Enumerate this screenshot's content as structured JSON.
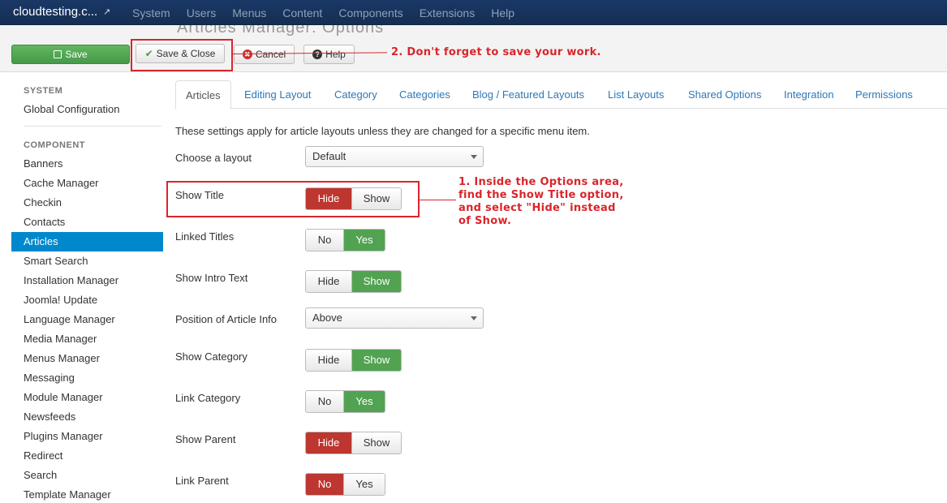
{
  "navbar": {
    "site_name": "cloudtesting.c...",
    "external_icon": "external-link-icon",
    "menu": [
      "System",
      "Users",
      "Menus",
      "Content",
      "Components",
      "Extensions",
      "Help"
    ]
  },
  "toolbar": {
    "ghost_title": "Articles Manager: Options",
    "save_label": "Save",
    "save_close_label": "Save & Close",
    "cancel_label": "Cancel",
    "help_label": "Help"
  },
  "annotations": {
    "note_save": "2. Don't forget to save your work.",
    "note_title_1": "1. Inside the Options area,",
    "note_title_2": "find the Show Title option,",
    "note_title_3": "and select \"Hide\" instead",
    "note_title_4": "of Show."
  },
  "sidebar": {
    "system_heading": "SYSTEM",
    "global_config": "Global Configuration",
    "component_heading": "COMPONENT",
    "items": [
      "Banners",
      "Cache Manager",
      "Checkin",
      "Contacts",
      "Articles",
      "Smart Search",
      "Installation Manager",
      "Joomla! Update",
      "Language Manager",
      "Media Manager",
      "Menus Manager",
      "Messaging",
      "Module Manager",
      "Newsfeeds",
      "Plugins Manager",
      "Redirect",
      "Search",
      "Template Manager"
    ],
    "active_item": "Articles"
  },
  "tabs": [
    "Articles",
    "Editing Layout",
    "Category",
    "Categories",
    "Blog / Featured Layouts",
    "List Layouts",
    "Shared Options",
    "Integration",
    "Permissions"
  ],
  "form": {
    "description": "These settings apply for article layouts unless they are changed for a specific menu item.",
    "choose_layout": {
      "label": "Choose a layout",
      "value": "Default"
    },
    "show_title": {
      "label": "Show Title",
      "options": [
        "Hide",
        "Show"
      ],
      "selected": "Hide"
    },
    "linked_titles": {
      "label": "Linked Titles",
      "options": [
        "No",
        "Yes"
      ],
      "selected": "Yes"
    },
    "show_intro": {
      "label": "Show Intro Text",
      "options": [
        "Hide",
        "Show"
      ],
      "selected": "Show"
    },
    "position_info": {
      "label": "Position of Article Info",
      "value": "Above"
    },
    "show_category": {
      "label": "Show Category",
      "options": [
        "Hide",
        "Show"
      ],
      "selected": "Show"
    },
    "link_category": {
      "label": "Link Category",
      "options": [
        "No",
        "Yes"
      ],
      "selected": "Yes"
    },
    "show_parent": {
      "label": "Show Parent",
      "options": [
        "Hide",
        "Show"
      ],
      "selected": "Hide"
    },
    "link_parent": {
      "label": "Link Parent",
      "options": [
        "No",
        "Yes"
      ],
      "selected": "No"
    }
  },
  "colors": {
    "navbar": "#17365e",
    "save_green": "#51a351",
    "toggle_red": "#bd362f",
    "active_blue": "#0088cc",
    "annotation_red": "#d9252b"
  }
}
